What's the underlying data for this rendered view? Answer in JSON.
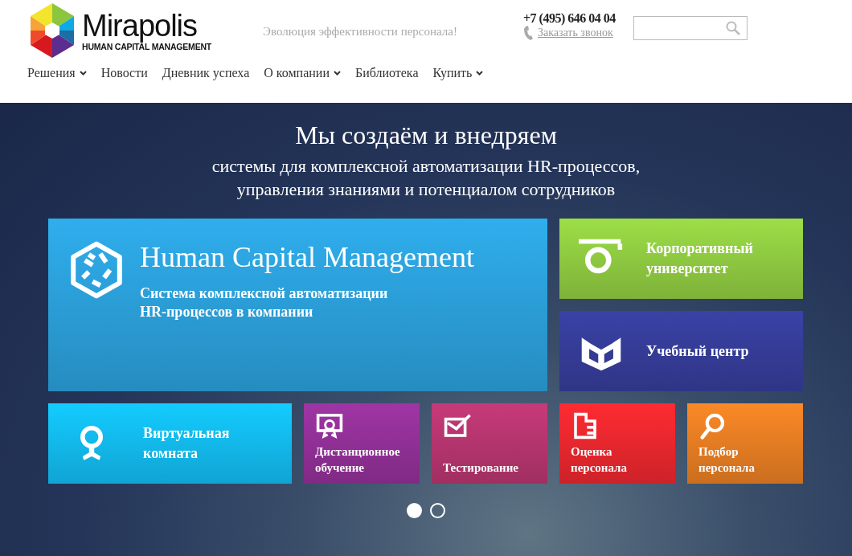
{
  "header": {
    "logo": {
      "name": "Mirapolis",
      "tagline": "HUMAN CAPITAL MANAGEMENT"
    },
    "slogan": "Эволюция эффективности персонала!",
    "phone": "+7 (495) 646 04 04",
    "callback_link": "Заказать звонок"
  },
  "nav": [
    {
      "label": "Решения",
      "dropdown": true
    },
    {
      "label": "Новости",
      "dropdown": false
    },
    {
      "label": "Дневник успеха",
      "dropdown": false
    },
    {
      "label": "О компании",
      "dropdown": true
    },
    {
      "label": "Библиотека",
      "dropdown": false
    },
    {
      "label": "Купить",
      "dropdown": true
    }
  ],
  "hero": {
    "title": "Мы создаём и внедряем",
    "subtitle_lines": [
      "системы для комплексной автоматизации HR-процессов,",
      "управления знаниями и потенциалом сотрудников"
    ]
  },
  "tiles": [
    {
      "kind": "large",
      "title": "Human Capital Management",
      "subtitle_lines": [
        "Система комплексной автоматизации",
        "HR-процессов в компании"
      ],
      "color": "#2a9bd4"
    },
    {
      "kind": "wide",
      "title_lines": [
        "Корпоративный",
        "университет"
      ],
      "color": "#8cc63f"
    },
    {
      "kind": "wide",
      "title_lines": [
        "Учебный центр"
      ],
      "color": "#343b94"
    },
    {
      "kind": "medium",
      "title_lines": [
        "Виртуальная",
        "комната"
      ],
      "color": "#12b6ea"
    },
    {
      "kind": "small",
      "title_lines": [
        "Дистанционное",
        "обучение"
      ],
      "color": "#8e2f93"
    },
    {
      "kind": "small",
      "title_lines": [
        "Тестирование"
      ],
      "color": "#b2346c"
    },
    {
      "kind": "small",
      "title_lines": [
        "Оценка",
        "персонала"
      ],
      "color": "#e4262d"
    },
    {
      "kind": "small",
      "title_lines": [
        "Подбор",
        "персонала"
      ],
      "color": "#e07a22"
    }
  ],
  "pager": [
    {
      "selected": true
    },
    {
      "selected": false
    }
  ]
}
